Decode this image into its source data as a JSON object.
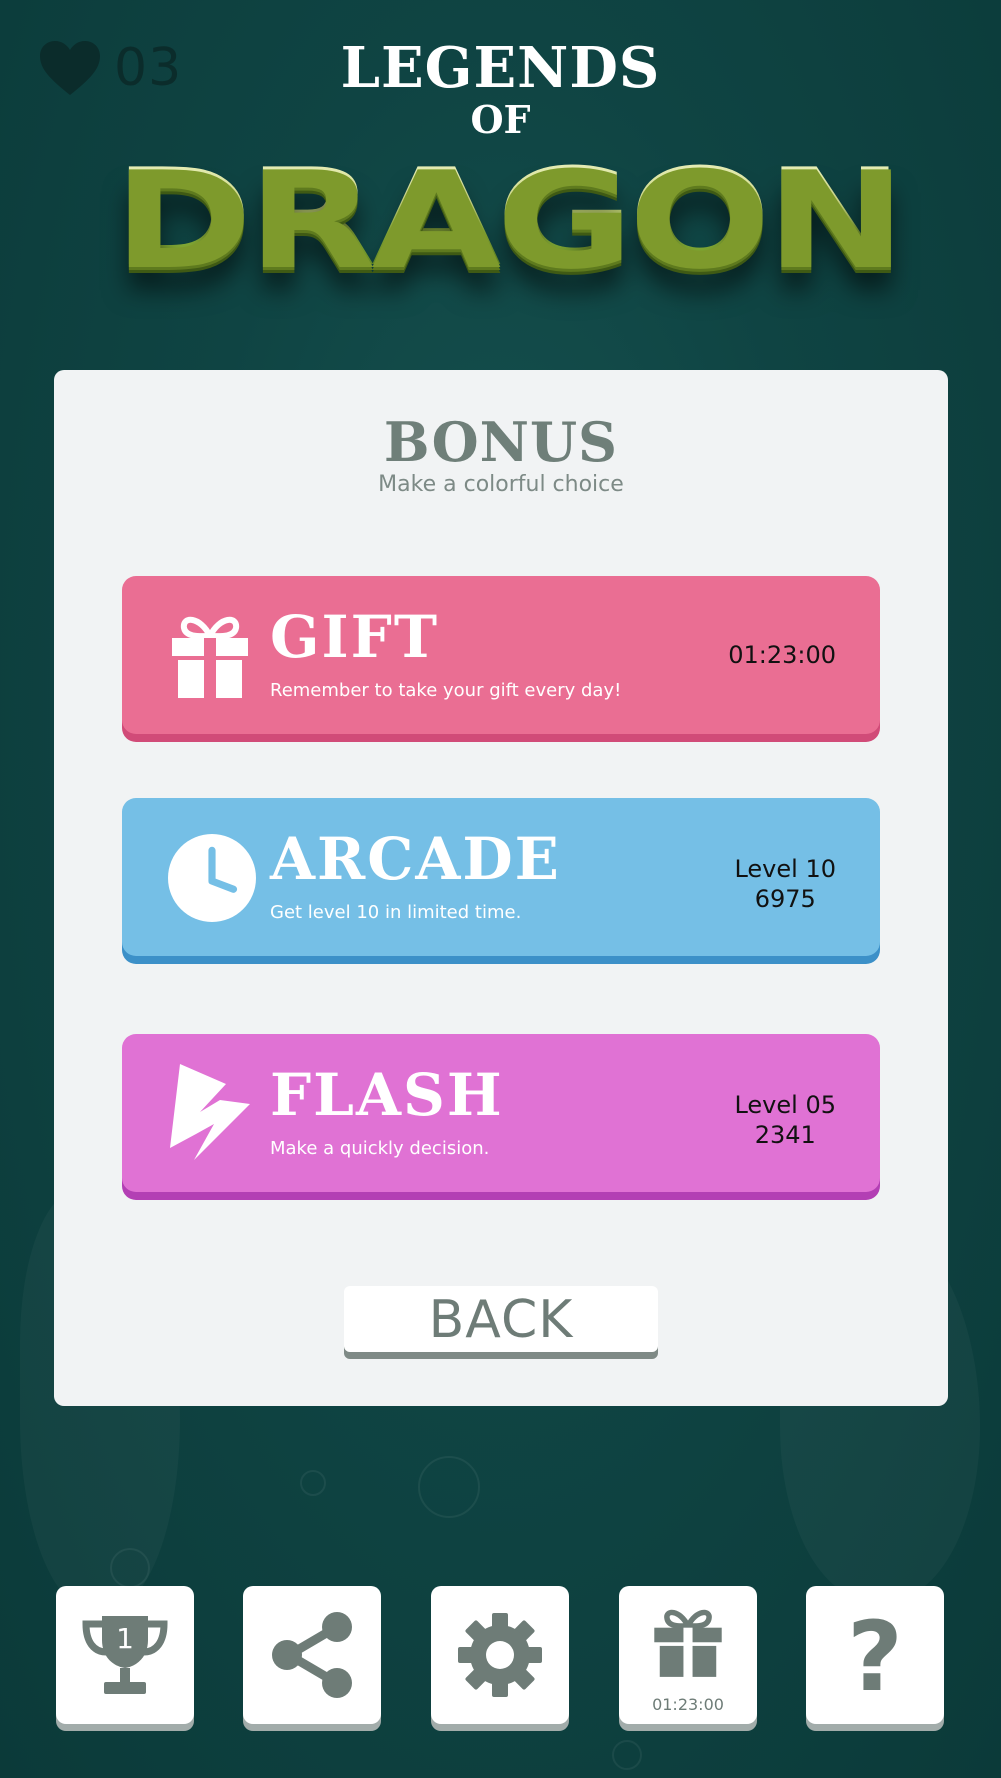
{
  "status": {
    "lives": "03"
  },
  "logo": {
    "line1": "LEGENDS",
    "line2": "OF",
    "line3": "DRAGON"
  },
  "panel": {
    "title": "BONUS",
    "subtitle": "Make a colorful choice",
    "modes": [
      {
        "title": "GIFT",
        "description": "Remember to take your gift every day!",
        "info_line1": "01:23:00",
        "info_line2": "",
        "color": "#ea6e93",
        "icon": "gift-icon"
      },
      {
        "title": "ARCADE",
        "description": "Get level 10 in limited time.",
        "info_line1": "Level 10",
        "info_line2": "6975",
        "color": "#75bfe6",
        "icon": "clock-icon"
      },
      {
        "title": "FLASH",
        "description": "Make a quickly decision.",
        "info_line1": "Level 05",
        "info_line2": "2341",
        "color": "#e072d4",
        "icon": "lightning-icon"
      }
    ],
    "back_label": "BACK"
  },
  "bottom_bar": {
    "trophy_rank": "1",
    "gift_timer": "01:23:00",
    "icons": [
      "trophy-icon",
      "share-icon",
      "gear-icon",
      "gift-icon",
      "help-icon"
    ]
  },
  "colors": {
    "background": "#0f4443",
    "icon_gray": "#6e7c77",
    "gift": "#ea6e93",
    "arcade": "#75bfe6",
    "flash": "#e072d4"
  }
}
